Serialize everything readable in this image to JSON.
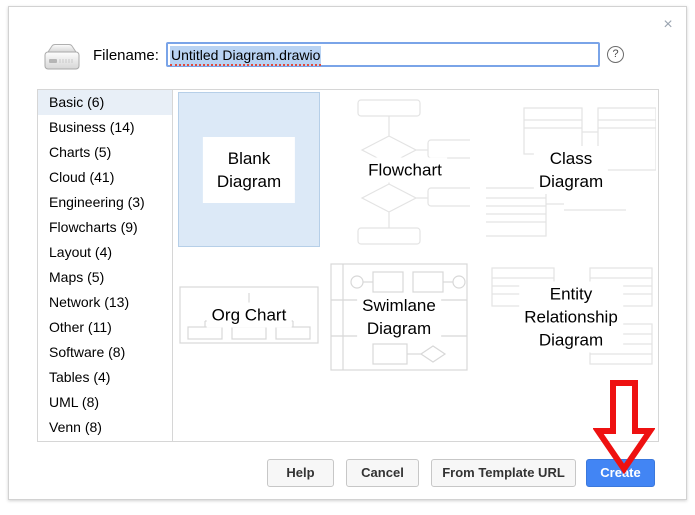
{
  "dialog": {
    "close_label": "×",
    "disk_icon": "hard-disk-icon",
    "filename_label": "Filename:",
    "filename_value": "Untitled Diagram.drawio",
    "filename_placeholder": "Untitled Diagram.drawio",
    "help_icon_label": "?"
  },
  "sidebar": {
    "items": [
      {
        "label": "Basic (6)",
        "selected": true
      },
      {
        "label": "Business (14)",
        "selected": false
      },
      {
        "label": "Charts (5)",
        "selected": false
      },
      {
        "label": "Cloud (41)",
        "selected": false
      },
      {
        "label": "Engineering (3)",
        "selected": false
      },
      {
        "label": "Flowcharts (9)",
        "selected": false
      },
      {
        "label": "Layout (4)",
        "selected": false
      },
      {
        "label": "Maps (5)",
        "selected": false
      },
      {
        "label": "Network (13)",
        "selected": false
      },
      {
        "label": "Other (11)",
        "selected": false
      },
      {
        "label": "Software (8)",
        "selected": false
      },
      {
        "label": "Tables (4)",
        "selected": false
      },
      {
        "label": "UML (8)",
        "selected": false
      },
      {
        "label": "Venn (8)",
        "selected": false
      }
    ]
  },
  "templates": [
    {
      "label": "Blank\nDiagram",
      "selected": true
    },
    {
      "label": "Flowchart",
      "selected": false
    },
    {
      "label": "Class\nDiagram",
      "selected": false
    },
    {
      "label": "Org Chart",
      "selected": false
    },
    {
      "label": "Swimlane\nDiagram",
      "selected": false
    },
    {
      "label": "Entity\nRelationship\nDiagram",
      "selected": false
    }
  ],
  "footer": {
    "help_label": "Help",
    "cancel_label": "Cancel",
    "template_url_label": "From Template URL",
    "create_label": "Create"
  },
  "colors": {
    "accent_blue": "#4285f4",
    "selection_blue": "#b9d3f3",
    "tile_selected_fill": "#dce9f7",
    "sidebar_selected": "#e8eff7",
    "annotation_red": "#ee1111"
  }
}
